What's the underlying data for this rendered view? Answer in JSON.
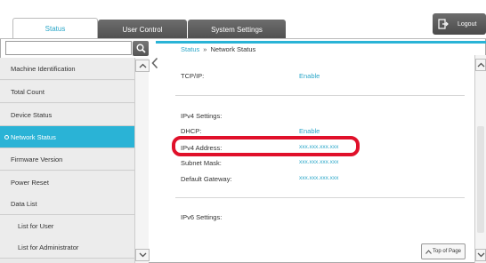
{
  "tabs": {
    "status": "Status",
    "user_control": "User Control",
    "system_settings": "System Settings"
  },
  "logout_label": "Logout",
  "search": {
    "placeholder": "",
    "value": ""
  },
  "sidebar": {
    "items": [
      {
        "label": "Machine Identification"
      },
      {
        "label": "Total Count"
      },
      {
        "label": "Device Status"
      },
      {
        "label": "Network Status"
      },
      {
        "label": "Firmware Version"
      },
      {
        "label": "Power Reset"
      },
      {
        "label": "Data List"
      },
      {
        "label": "List for User"
      },
      {
        "label": "List for Administrator"
      }
    ],
    "active": "Network Status"
  },
  "breadcrumb": {
    "parent": "Status",
    "separator": "»",
    "current": "Network Status"
  },
  "content": {
    "tcpip": {
      "label": "TCP/IP:",
      "value": "Enable"
    },
    "ipv4_settings": "IPv4 Settings:",
    "dhcp": {
      "label": "DHCP:",
      "value": "Enable"
    },
    "ipv4_address": {
      "label": "IPv4 Address:",
      "value": "xxx.xxx.xxx.xxx"
    },
    "subnet_mask": {
      "label": "Subnet Mask:",
      "value": "xxx.xxx.xxx.xxx"
    },
    "default_gateway": {
      "label": "Default Gateway:",
      "value": "xxx.xxx.xxx.xxx"
    },
    "ipv6_settings": "IPv6 Settings:"
  },
  "top_of_page_label": "Top of Page",
  "colors": {
    "accent": "#2ab3d6",
    "highlight": "#e0102a",
    "tab_dark": "#5a5a5a"
  }
}
